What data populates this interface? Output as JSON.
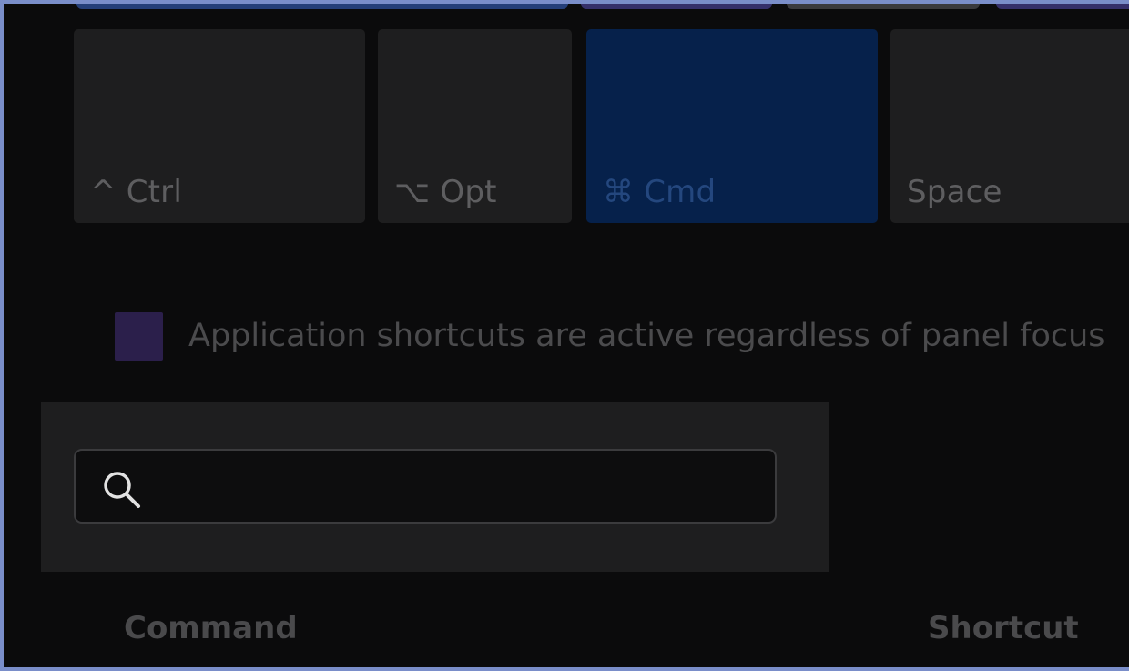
{
  "colors": {
    "frame_border": "#7a8ec9",
    "key_bg": "#1e1e1f",
    "key_active_bg": "#06214b",
    "checkbox": "#2b1f4b"
  },
  "modifier_keys": [
    {
      "label": "^ Ctrl",
      "active": false
    },
    {
      "label": "⌥ Opt",
      "active": false
    },
    {
      "label": "⌘ Cmd",
      "active": true
    },
    {
      "label": "Space",
      "active": false
    }
  ],
  "options": {
    "app_shortcuts_label": "Application shortcuts are active regardless of panel focus",
    "app_shortcuts_checked": true
  },
  "search": {
    "value": "",
    "placeholder": "",
    "icon": "search-icon"
  },
  "table": {
    "columns": [
      "Command",
      "Shortcut"
    ]
  }
}
